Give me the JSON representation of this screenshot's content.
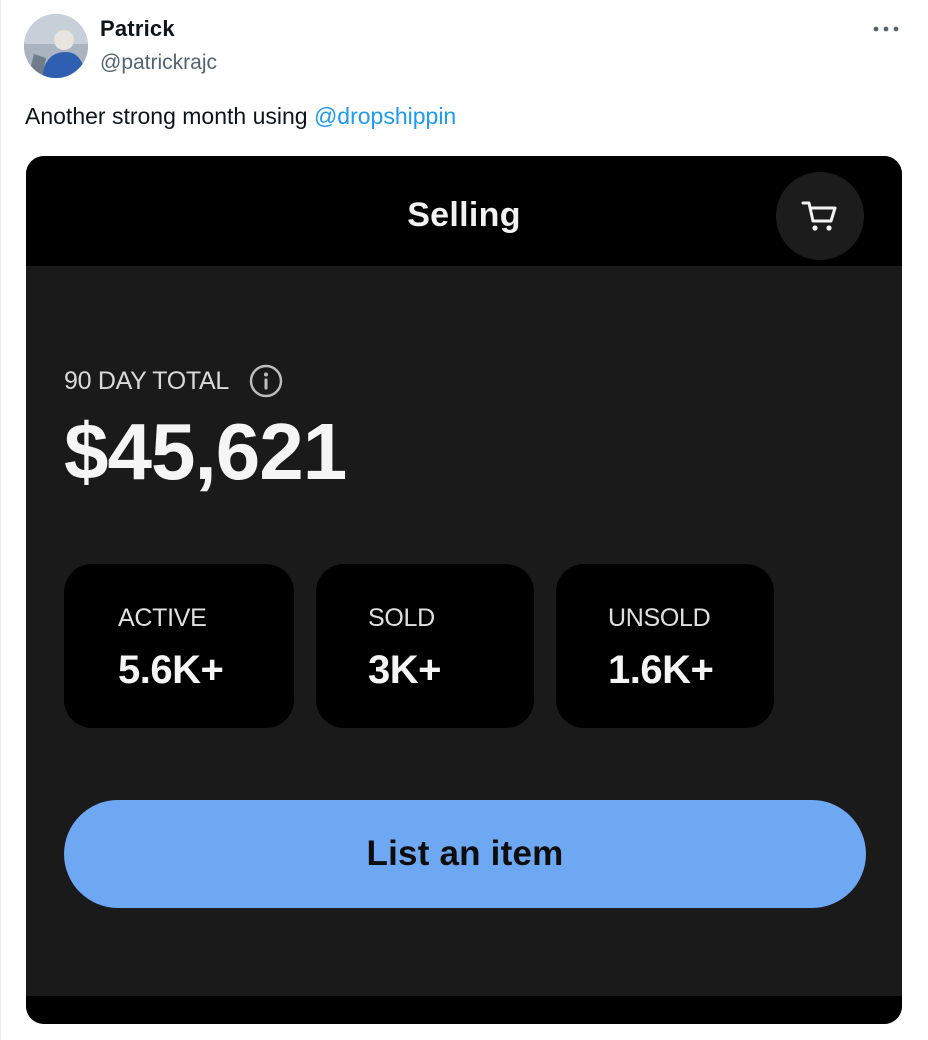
{
  "tweet": {
    "author_name": "Patrick",
    "author_handle": "@patrickrajc",
    "text_prefix": "Another strong month using ",
    "mention": "@dropshippin",
    "more_icon": "more-horizontal-icon",
    "avatar_icon": "profile-photo"
  },
  "card": {
    "header_title": "Selling",
    "cart_icon": "shopping-cart-icon",
    "total_label": "90 DAY TOTAL",
    "info_icon": "info-circle-icon",
    "total_value": "$45,621",
    "stats": [
      {
        "label": "ACTIVE",
        "value": "5.6K+"
      },
      {
        "label": "SOLD",
        "value": "3K+"
      },
      {
        "label": "UNSOLD",
        "value": "1.6K+"
      }
    ],
    "cta_label": "List an item"
  },
  "colors": {
    "mention": "#1d9bf0",
    "card_bg": "#1a1a1a",
    "header_bg": "#000000",
    "stat_bg": "#000000",
    "cta_bg": "#6ea7f2",
    "handle": "#536471"
  }
}
